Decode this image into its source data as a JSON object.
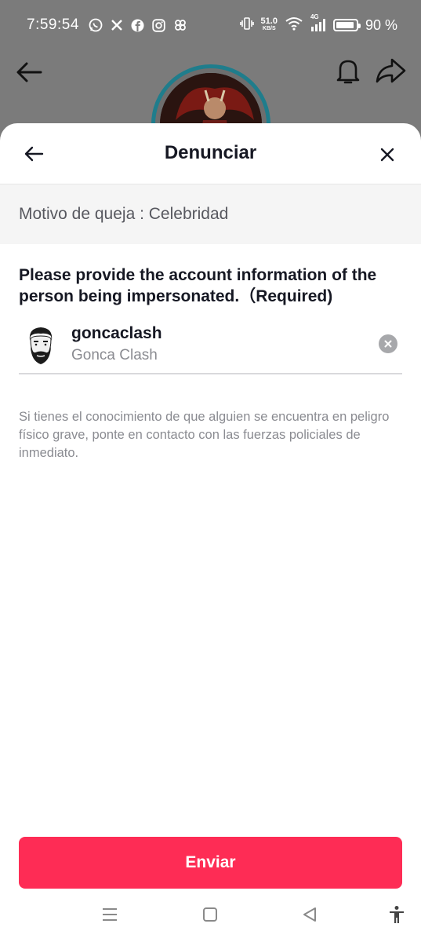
{
  "status_bar": {
    "time": "7:59:54",
    "app_icons": [
      "whatsapp-icon",
      "x-icon",
      "facebook-icon",
      "instagram-icon",
      "threads-icon"
    ],
    "vibrate_icon": "vibrate-icon",
    "net_speed_value": "51.0",
    "net_speed_unit": "KB/S",
    "network_type": "4G",
    "battery_level": 0.9,
    "battery_text": "90 %"
  },
  "background_header": {
    "icons": [
      "back-arrow-icon",
      "bell-icon",
      "share-icon"
    ]
  },
  "sheet": {
    "title": "Denunciar",
    "reason": "Motivo de queja : Celebridad",
    "question": "Please provide the account information of the person being impersonated.（Required)",
    "account": {
      "username": "goncaclash",
      "display_name": "Gonca Clash"
    },
    "notice": "Si tienes el conocimiento de que alguien se encuentra en peligro físico grave, ponte en contacto con las fuerzas policiales de inmediato.",
    "submit_label": "Enviar"
  },
  "nav_bar": {
    "icons": [
      "menu-icon",
      "home-square-icon",
      "back-triangle-icon",
      "accessibility-icon"
    ]
  },
  "colors": {
    "accent": "#fe2c55",
    "title_text": "#161823",
    "secondary_text": "#8a8b91",
    "reason_bg": "#f5f5f5",
    "overlay_bg": "#7b7b7b"
  }
}
